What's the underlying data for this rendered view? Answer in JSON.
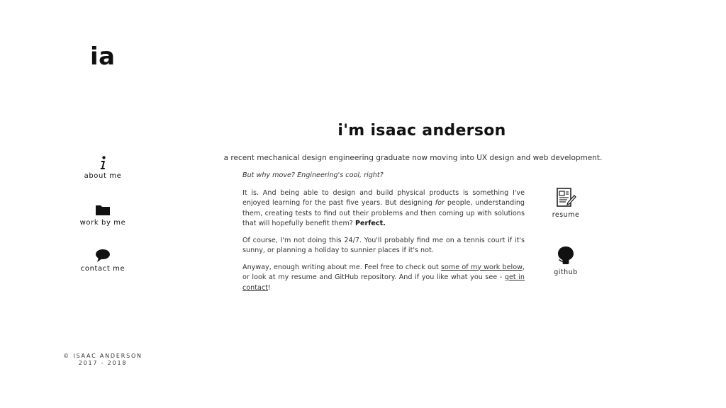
{
  "logo": "ia",
  "nav": {
    "about": {
      "icon": "info-icon",
      "label": "about me"
    },
    "work": {
      "icon": "folder-icon",
      "label": "work by me"
    },
    "contact": {
      "icon": "speech-bubble-icon",
      "label": "contact me"
    }
  },
  "footer": {
    "line1": "© ISAAC ANDERSON",
    "line2": "2017 - 2018"
  },
  "main": {
    "heading": "i'm isaac anderson",
    "subtitle": "a recent mechanical design engineering graduate now moving into UX design and web development.",
    "question": "But why move? Engineering's cool, right?",
    "p1_a": "It is. And being able to design and build physical products is something I've enjoyed learning for the past five years. But designing ",
    "p1_em": "for",
    "p1_b": " people, understanding them, creating tests to find out their problems and then coming up with solutions that will hopefully benefit them? ",
    "p1_strong": "Perfect.",
    "p2": "Of course, I'm not doing this 24/7. You'll probably find me on a tennis court if it's sunny, or planning a holiday to sunnier places if it's not.",
    "p3_a": "Anyway, enough writing about me. Feel free to check out ",
    "p3_link1": "some of my work below",
    "p3_b": ", or look at my resume and GitHub repository. And if you like what you see - ",
    "p3_link2": "get in contact",
    "p3_c": "!"
  },
  "side": {
    "resume": {
      "icon": "resume-icon",
      "label": "resume"
    },
    "github": {
      "icon": "github-icon",
      "label": "github"
    }
  },
  "colors": {
    "background": "#ffffff",
    "text": "#222222",
    "accent": "#111111"
  }
}
